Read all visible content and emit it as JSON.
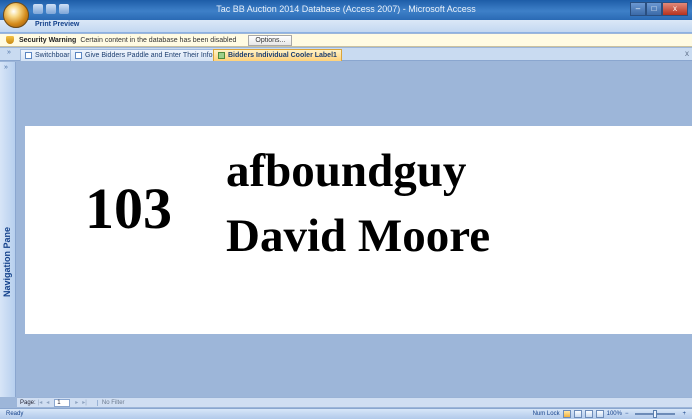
{
  "window": {
    "title": "Tac BB Auction 2014 Database (Access 2007) - Microsoft Access",
    "controls": {
      "minimize": "–",
      "maximize": "□",
      "close": "x"
    }
  },
  "ribbon": {
    "active_tab": "Print Preview"
  },
  "security_bar": {
    "title": "Security Warning",
    "message": "Certain content in the database has been disabled",
    "options_button": "Options..."
  },
  "document_tabs": [
    {
      "label": "Switchboard",
      "active": false
    },
    {
      "label": "Give Bidders Paddle and Enter Their Information",
      "active": false
    },
    {
      "label": "Bidders Individual Cooler Label1",
      "active": true
    }
  ],
  "navigation_pane": {
    "label": "Navigation Pane"
  },
  "label_record": {
    "bidder_number": "103",
    "username": "afboundguy",
    "full_name": "David Moore"
  },
  "page_nav": {
    "label": "Page:",
    "page_value": "1",
    "filter_text": "No Filter"
  },
  "status_bar": {
    "status": "Ready",
    "num_lock": "Num Lock",
    "zoom": "100%"
  },
  "colors": {
    "workspace": "#9db6d9",
    "title_bar": "#2a6ab4",
    "active_tab": "#ffd27a",
    "label_background": "#ffffff"
  }
}
